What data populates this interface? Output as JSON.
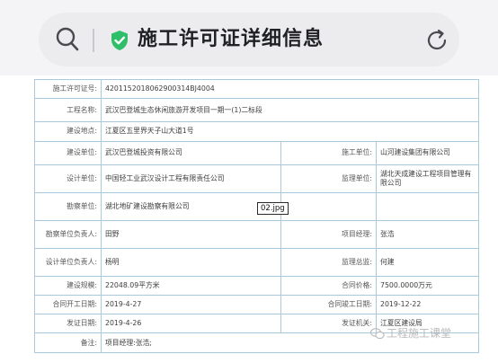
{
  "header": {
    "title": "施工许可证详细信息"
  },
  "table": {
    "permit_label": "施工许可证号:",
    "permit_value": "420115201806290031​4BJ4004",
    "project_label": "工程名称:",
    "project_value": "武汉巴登城生态休闲旅游开发项目一期一(1)二标段",
    "site_label": "建设地点:",
    "site_value": "江夏区五里界天子山大道1号",
    "builder_label": "建设单位:",
    "builder_value": "武汉巴登城投资有限公司",
    "contractor_label": "施工单位:",
    "contractor_value": "山河建设集团有限公司",
    "designer_label": "设计单位:",
    "designer_value": "中国轻工业武汉设计工程有限责任公司",
    "supervisor_label": "监理单位:",
    "supervisor_value": "湖北天成建设工程项目管理有限公司",
    "survey_label": "勘察单位:",
    "survey_value": "湖北地矿建设勘察有限公司",
    "survey_lead_label": "勘察单位负责人:",
    "survey_lead_value": "田野",
    "pm_label": "项目经理:",
    "pm_value": "张浩",
    "design_lead_label": "设计单位负责人:",
    "design_lead_value": "杨明",
    "chief_sup_label": "监理总监:",
    "chief_sup_value": "何建",
    "scale_label": "建设规模:",
    "scale_value": "22048.09平方米",
    "price_label": "合同价格:",
    "price_value": "7500.0000万元",
    "start_label": "合同开工日期:",
    "start_value": "2019-4-27",
    "end_label": "合同竣工日期:",
    "end_value": "2019-12-22",
    "issue_label": "发证日期:",
    "issue_value": "2019-4-26",
    "authority_label": "发证机关:",
    "authority_value": "江夏区建设局",
    "remark_label": "备注:",
    "remark_value": "项目经理:张浩;"
  },
  "overlay": {
    "file_tag": "02.jpg",
    "watermark": "工程施工课堂"
  },
  "colors": {
    "border": "#a9c9dc",
    "shield": "#2fbf6a",
    "topbar": "#f4f4f6"
  }
}
